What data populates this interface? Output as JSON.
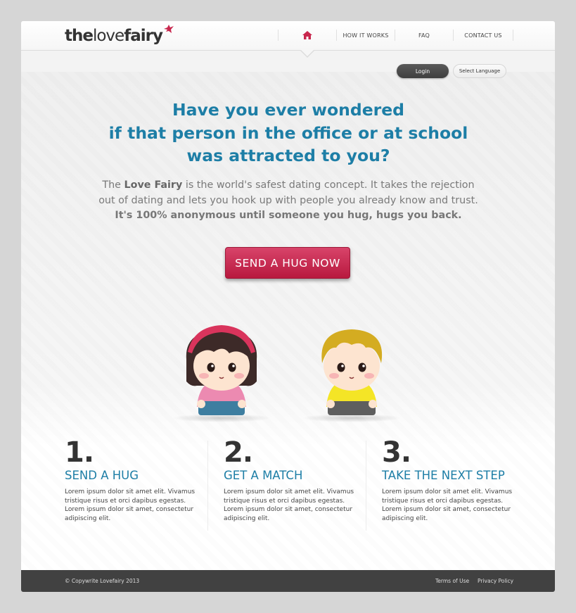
{
  "brand": {
    "logo_the": "the",
    "logo_love": "love",
    "logo_fairy": "fairy",
    "accent": "#c8274d",
    "headline_color": "#1d7ea6"
  },
  "nav": {
    "home_icon": "home-icon",
    "items": [
      "HOW IT WORKS",
      "FAQ",
      "CONTACT US"
    ]
  },
  "account": {
    "login_label": "Login",
    "language_label": "Select Language"
  },
  "hero": {
    "headline": [
      "Have you ever wondered",
      "if that person in the office or at school",
      "was attracted to you?"
    ],
    "sub_pre": "The ",
    "sub_bold": "Love Fairy",
    "sub_post": " is the world's safest dating concept. It takes the rejection",
    "sub_line2": "out of dating and lets you hook up with people you already know and trust.",
    "sub_line3": "It's 100% anonymous until someone you hug, hugs you back.",
    "cta_label": "SEND A HUG NOW"
  },
  "steps": [
    {
      "num": "1.",
      "title": "SEND A HUG",
      "text": "Lorem ipsum dolor sit amet elit. Vivamus tristique risus et orci dapibus egestas. Lorem ipsum dolor sit amet, consectetur adipiscing elit."
    },
    {
      "num": "2.",
      "title": "GET A MATCH",
      "text": "Lorem ipsum dolor sit amet elit. Vivamus tristique risus et orci dapibus egestas. Lorem ipsum dolor sit amet, consectetur adipiscing elit."
    },
    {
      "num": "3.",
      "title": "TAKE THE NEXT STEP",
      "text": "Lorem ipsum dolor sit amet elit. Vivamus tristique risus et orci dapibus egestas. Lorem ipsum dolor sit amet, consectetur adipiscing elit."
    }
  ],
  "footer": {
    "copyright": "© Copywrite Lovefairy 2013",
    "terms": "Terms of Use",
    "privacy": "Privacy Policy"
  }
}
